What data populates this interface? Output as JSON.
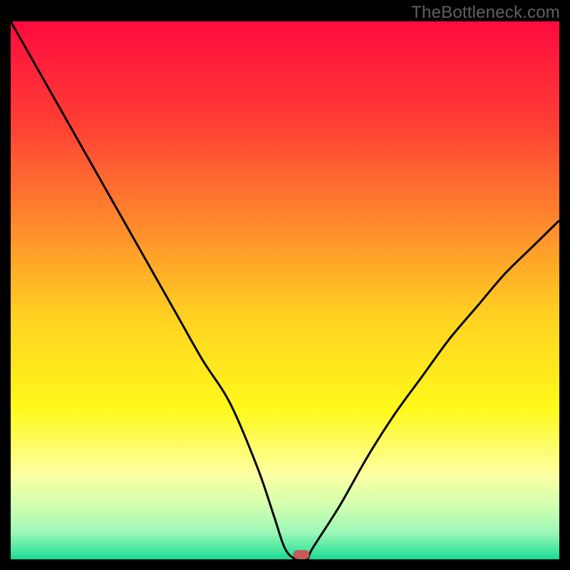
{
  "watermark": "TheBottleneck.com",
  "chart_data": {
    "type": "line",
    "title": "",
    "xlabel": "",
    "ylabel": "",
    "xlim": [
      0,
      100
    ],
    "ylim": [
      0,
      100
    ],
    "x": [
      0,
      5,
      10,
      15,
      20,
      25,
      30,
      35,
      40,
      45,
      48,
      50,
      52,
      54,
      55,
      60,
      65,
      70,
      75,
      80,
      85,
      90,
      95,
      100
    ],
    "values": [
      100,
      91,
      82,
      73,
      64,
      55,
      46,
      37,
      29,
      17,
      8,
      2,
      0,
      0,
      2,
      10,
      19,
      27,
      34,
      41,
      47,
      53,
      58,
      63
    ],
    "marker": {
      "x": 53,
      "y": 0.6
    },
    "gradient_stops": [
      {
        "offset": 0,
        "color": "#ff0b3e"
      },
      {
        "offset": 0.18,
        "color": "#ff3b35"
      },
      {
        "offset": 0.38,
        "color": "#ff8b2d"
      },
      {
        "offset": 0.55,
        "color": "#ffd221"
      },
      {
        "offset": 0.72,
        "color": "#fff91a"
      },
      {
        "offset": 0.84,
        "color": "#fdffa0"
      },
      {
        "offset": 0.9,
        "color": "#d2ffb0"
      },
      {
        "offset": 0.95,
        "color": "#9cf7b6"
      },
      {
        "offset": 0.985,
        "color": "#42e6a0"
      },
      {
        "offset": 1.0,
        "color": "#19d98f"
      }
    ]
  }
}
